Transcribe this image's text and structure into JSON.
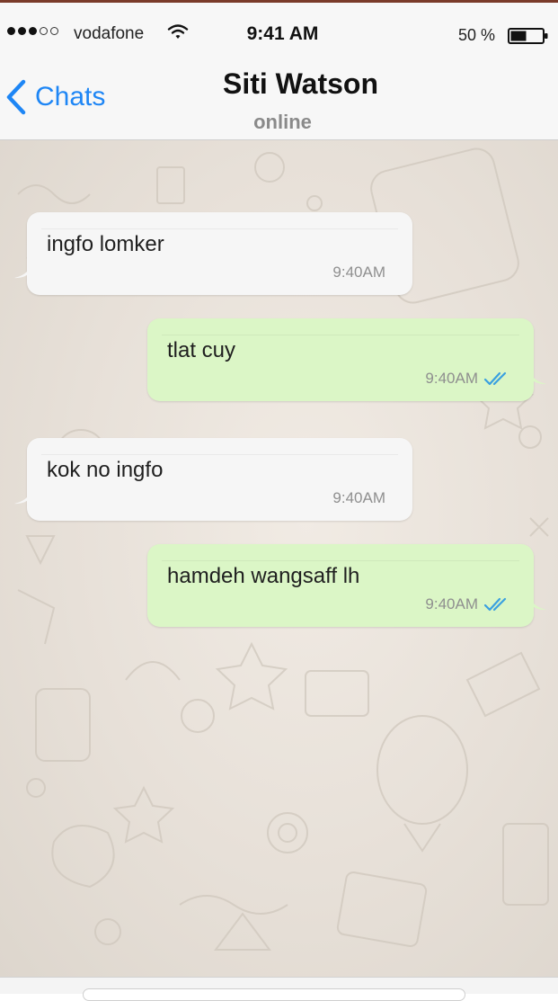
{
  "status_bar": {
    "signal_dots_filled": 3,
    "signal_dots_total": 5,
    "carrier": "vodafone",
    "wifi_icon": "wifi-icon",
    "time": "9:41 AM",
    "battery_percent": "50 %",
    "battery_level": 0.5
  },
  "nav": {
    "back_label": "Chats",
    "back_icon": "chevron-left-icon",
    "contact_name": "Siti Watson",
    "contact_status": "online"
  },
  "messages": [
    {
      "direction": "incoming",
      "text": "ingfo lomker",
      "time": "9:40AM"
    },
    {
      "direction": "outgoing",
      "text": "tlat cuy",
      "time": "9:40AM",
      "status_icon": "double-check-icon"
    },
    {
      "direction": "incoming",
      "text": "kok no ingfo",
      "time": "9:40AM"
    },
    {
      "direction": "outgoing",
      "text": "hamdeh wangsaff lh",
      "time": "9:40AM",
      "status_icon": "double-check-icon"
    }
  ],
  "colors": {
    "accent": "#1e86f5",
    "incoming_bubble": "#f6f6f6",
    "outgoing_bubble": "#dbf6c6",
    "read_ticks": "#3aa0e0",
    "chat_background": "#e9e2da"
  }
}
